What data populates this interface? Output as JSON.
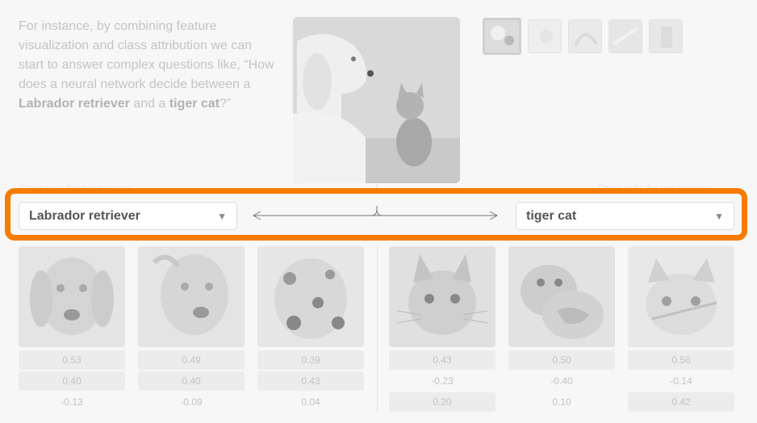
{
  "intro": {
    "part1": "For instance, by combining feature visualization and class attribution we can start to answer complex questions like, “How does a neural network decide between a ",
    "class_a": "Labrador retriever",
    "part2": " and a ",
    "class_b": "tiger cat",
    "part3": "?”"
  },
  "main_image": {
    "icon": "dog-and-kitten-photo"
  },
  "thumbnails": [
    {
      "icon": "dog-cat-thumb",
      "active": true
    },
    {
      "icon": "thumb-2",
      "active": false
    },
    {
      "icon": "thumb-3",
      "active": false
    },
    {
      "icon": "thumb-4",
      "active": false
    },
    {
      "icon": "thumb-5",
      "active": false
    }
  ],
  "faded_left_label": "Show only the top neurons",
  "faded_right_label": "Show only the top neurons",
  "left_select": {
    "value": "Labrador retriever"
  },
  "right_select": {
    "value": "tiger cat"
  },
  "left_columns": [
    {
      "icon": "dog-feature-vis",
      "values": [
        "0.53",
        "0.40",
        "-0.13"
      ]
    },
    {
      "icon": "dog-feature-vis",
      "values": [
        "0.49",
        "0.40",
        "-0.09"
      ]
    },
    {
      "icon": "dalmatian-feature-vis",
      "values": [
        "0.39",
        "0.43",
        "0.04"
      ]
    }
  ],
  "right_columns": [
    {
      "icon": "cat-feature-vis",
      "values": [
        "0.43",
        "-0.23",
        "0.20"
      ]
    },
    {
      "icon": "snake-dog-feature-vis",
      "values": [
        "0.50",
        "-0.40",
        "0.10"
      ]
    },
    {
      "icon": "cat-feature-vis",
      "values": [
        "0.56",
        "-0.14",
        "0.42"
      ]
    }
  ],
  "colors": {
    "highlight": "#f57c00"
  }
}
